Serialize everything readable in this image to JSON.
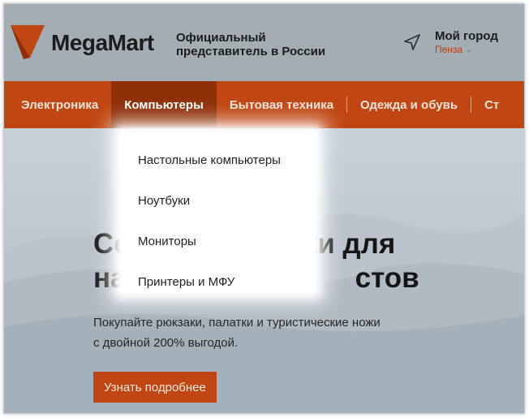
{
  "brand": {
    "name": "MegaMart",
    "tagline_line1": "Официальный",
    "tagline_line2": "представитель в России",
    "colors": {
      "accent": "#c04613",
      "accent_dark": "#8f2f08"
    }
  },
  "location": {
    "icon": "navigation-arrow-icon",
    "title": "Мой город",
    "selected_city": "Пенза",
    "chevron_icon": "chevron-down-icon"
  },
  "nav": {
    "items": [
      {
        "label": "Электроника"
      },
      {
        "label": "Компьютеры",
        "active": true
      },
      {
        "label": "Бытовая техника"
      },
      {
        "label": "Одежда и обувь"
      },
      {
        "label": "Ст"
      }
    ]
  },
  "dropdown": {
    "items": [
      {
        "label": "Настольные компьютеры"
      },
      {
        "label": "Ноутбуки"
      },
      {
        "label": "Мониторы"
      },
      {
        "label": "Принтеры и МФУ"
      }
    ]
  },
  "hero": {
    "title_line1": "Се                      ки для",
    "title_line2": "на                             стов",
    "text_line1": "Покупайте рюкзаки, палатки и туристические ножи",
    "text_line2": "с  двойной 200% выгодой.",
    "button_label": "Узнать подробнее"
  }
}
